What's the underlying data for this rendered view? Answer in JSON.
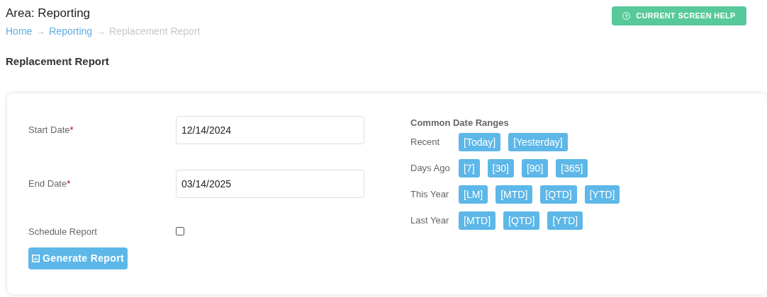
{
  "area_title": "Area: Reporting",
  "breadcrumb": [
    {
      "kind": "link",
      "label": "Home"
    },
    {
      "kind": "separator",
      "label": "→"
    },
    {
      "kind": "link",
      "label": "Reporting"
    },
    {
      "kind": "separator",
      "label": "→"
    },
    {
      "kind": "current",
      "label": "Replacement Report"
    }
  ],
  "help_button": {
    "icon": "?",
    "label": "CURRENT SCREEN HELP"
  },
  "page_title": "Replacement Report",
  "form": {
    "fields": [
      {
        "kind": "date",
        "label": "Start Date",
        "required_mark": "*",
        "value": "12/14/2024"
      },
      {
        "kind": "date",
        "label": "End Date",
        "required_mark": "*",
        "value": "03/14/2025"
      },
      {
        "kind": "checkbox",
        "label": "Schedule Report",
        "checked": false
      }
    ],
    "submit_button": "Generate Report"
  },
  "date_ranges": {
    "title": "Common Date Ranges",
    "groups": [
      {
        "label": "Recent",
        "buttons": [
          "[Today]",
          "[Yesterday]"
        ]
      },
      {
        "label": "Days Ago",
        "buttons": [
          "[7]",
          "[30]",
          "[90]",
          "[365]"
        ]
      },
      {
        "label": "This Year",
        "buttons": [
          "[LM]",
          "[MTD]",
          "[QTD]",
          "[YTD]"
        ]
      },
      {
        "label": "Last Year",
        "buttons": [
          "[MTD]",
          "[QTD]",
          "[YTD]"
        ]
      }
    ]
  }
}
